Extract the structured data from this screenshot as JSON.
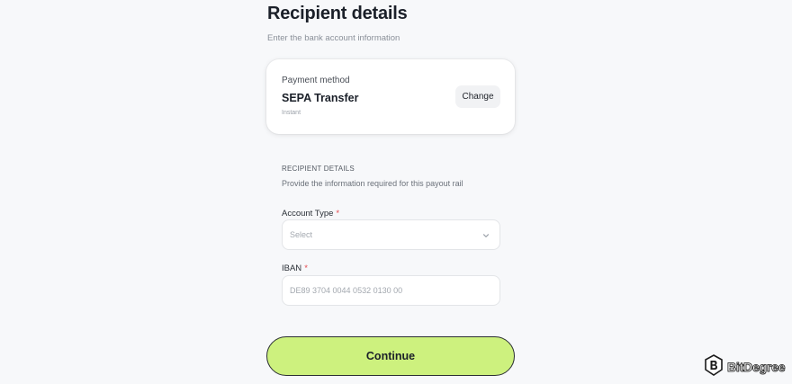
{
  "header": {
    "title": "Recipient details",
    "subtitle": "Enter the bank account information"
  },
  "payment_method": {
    "label": "Payment method",
    "name": "SEPA Transfer",
    "speed": "Instant",
    "change_label": "Change"
  },
  "recipient_section": {
    "heading": "RECIPIENT DETAILS",
    "description": "Provide the information required for this payout rail"
  },
  "form": {
    "account_type": {
      "label": "Account Type",
      "required_mark": "*",
      "placeholder": "Select"
    },
    "iban": {
      "label": "IBAN",
      "required_mark": "*",
      "placeholder": "DE89 3704 0044 0532 0130 00"
    }
  },
  "actions": {
    "continue_label": "Continue"
  },
  "watermark": {
    "text": "BitDegree",
    "icon": "bitdegree-logo-icon"
  },
  "colors": {
    "accent": "#cdf17e",
    "required": "#e5484d",
    "background": "#f7f8fa"
  }
}
